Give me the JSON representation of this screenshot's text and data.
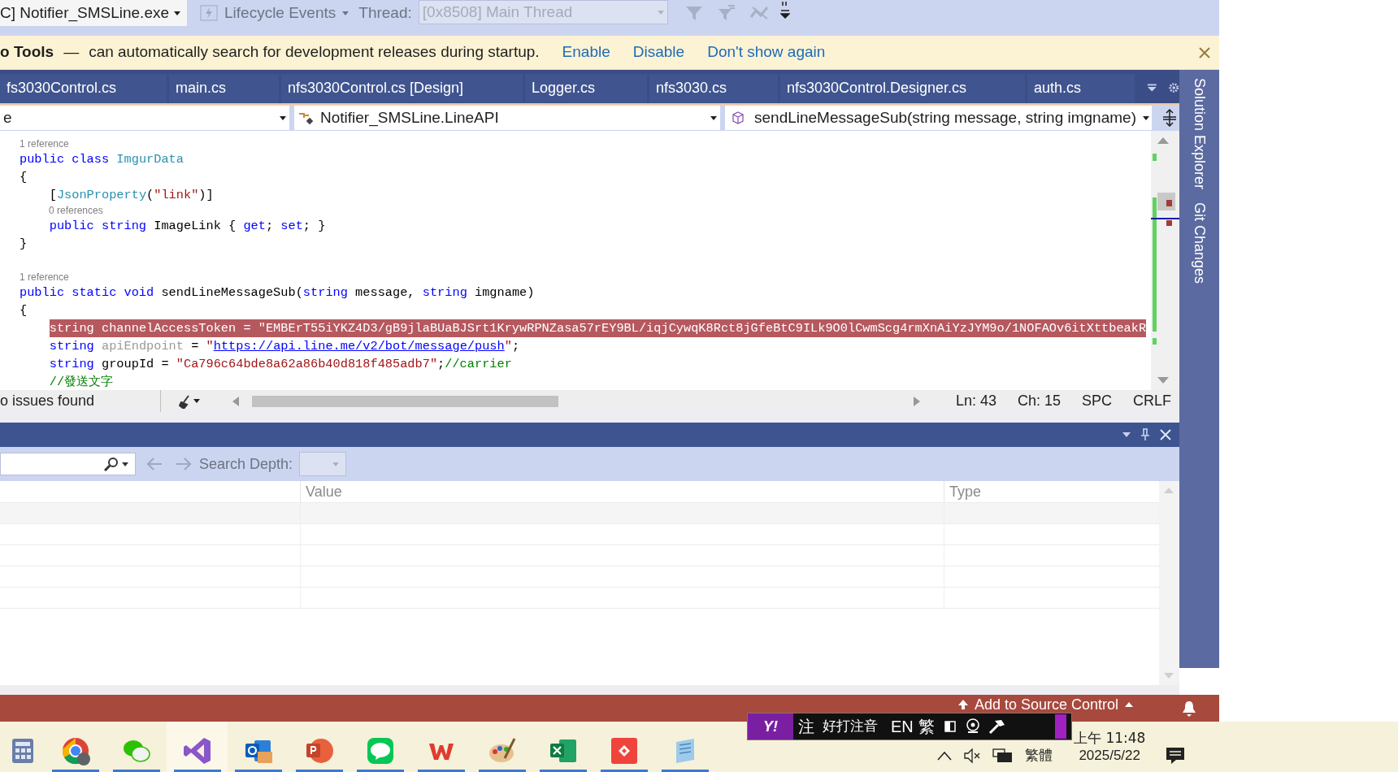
{
  "toolbar": {
    "process": "C] Notifier_SMSLine.exe",
    "lifecycle": "Lifecycle Events",
    "thread_label": "Thread:",
    "thread": {
      "value": "[0x8508] Main Thread",
      "disabled": true
    }
  },
  "infobar": {
    "title": "o Tools",
    "dash": "—",
    "message": "can automatically search for development releases during startup.",
    "links": [
      "Enable",
      "Disable",
      "Don't show again"
    ]
  },
  "tabs": [
    "fs3030Control.cs",
    "main.cs",
    "nfs3030Control.cs [Design]",
    "Logger.cs",
    "nfs3030.cs",
    "nfs3030Control.Designer.cs",
    "auth.cs"
  ],
  "nav": {
    "project": "e",
    "class": "Notifier_SMSLine.LineAPI",
    "member": "sendLineMessageSub(string message, string imgname)"
  },
  "code_lines": [
    {
      "kind": "reference",
      "text": "1 reference",
      "indented": false
    },
    {
      "kind": "code",
      "highlighted": false,
      "tokens": [
        {
          "t": "public class ",
          "kind": "kw"
        },
        {
          "t": "ImgurData",
          "kind": "type"
        }
      ]
    },
    {
      "kind": "code",
      "highlighted": false,
      "tokens": [
        {
          "t": "{",
          "kind": "plain"
        }
      ]
    },
    {
      "kind": "code",
      "highlighted": false,
      "tokens": [
        {
          "t": "    [",
          "kind": "plain"
        },
        {
          "t": "JsonProperty",
          "kind": "type"
        },
        {
          "t": "(",
          "kind": "plain"
        },
        {
          "t": "\"link\"",
          "kind": "str"
        },
        {
          "t": ")]",
          "kind": "plain"
        }
      ]
    },
    {
      "kind": "reference",
      "text": "0 references",
      "indented": true
    },
    {
      "kind": "code",
      "highlighted": false,
      "tokens": [
        {
          "t": "    public string ",
          "kind": "kw"
        },
        {
          "t": "ImageLink { ",
          "kind": "plain"
        },
        {
          "t": "get",
          "kind": "kw"
        },
        {
          "t": "; ",
          "kind": "plain"
        },
        {
          "t": "set",
          "kind": "kw"
        },
        {
          "t": "; }",
          "kind": "plain"
        }
      ]
    },
    {
      "kind": "code",
      "highlighted": false,
      "tokens": [
        {
          "t": "}",
          "kind": "plain"
        }
      ]
    },
    {
      "kind": "blank"
    },
    {
      "kind": "reference",
      "text": "1 reference",
      "indented": false
    },
    {
      "kind": "code",
      "highlighted": false,
      "tokens": [
        {
          "t": "public static void ",
          "kind": "kw"
        },
        {
          "t": "sendLineMessageSub(",
          "kind": "plain"
        },
        {
          "t": "string ",
          "kind": "kw"
        },
        {
          "t": "message, ",
          "kind": "plain"
        },
        {
          "t": "string ",
          "kind": "kw"
        },
        {
          "t": "imgname)",
          "kind": "plain"
        }
      ]
    },
    {
      "kind": "code",
      "highlighted": false,
      "tokens": [
        {
          "t": "{",
          "kind": "plain"
        }
      ]
    },
    {
      "kind": "code",
      "highlighted": true,
      "tokens": [
        {
          "t": "    string ",
          "kind": "kw"
        },
        {
          "t": "channelAccessToken = ",
          "kind": "plain"
        },
        {
          "t": "\"EMBErT55iYKZ4D3/gB9jlaBUaBJSrt1KrywRPNZasa57rEY9BL/iqjCywqK8Rct8jGfeBtC9ILk9O0lCwmScg4rmXnAiYzJYM9o/1NOFAOv6itXttbeakR",
          "kind": "str"
        }
      ]
    },
    {
      "kind": "code",
      "highlighted": false,
      "tokens": [
        {
          "t": "    string ",
          "kind": "kw"
        },
        {
          "t": "apiEndpoint",
          "kind": "dim"
        },
        {
          "t": " = ",
          "kind": "plain"
        },
        {
          "t": "\"",
          "kind": "str"
        },
        {
          "t": "https://api.line.me/v2/bot/message/push",
          "kind": "link"
        },
        {
          "t": "\"",
          "kind": "str"
        },
        {
          "t": ";",
          "kind": "plain"
        }
      ]
    },
    {
      "kind": "code",
      "highlighted": false,
      "tokens": [
        {
          "t": "    string ",
          "kind": "kw"
        },
        {
          "t": "groupId = ",
          "kind": "plain"
        },
        {
          "t": "\"Ca796c64bde8a62a86b40d818f485adb7\"",
          "kind": "str"
        },
        {
          "t": ";",
          "kind": "plain"
        },
        {
          "t": "//carrier",
          "kind": "cm"
        }
      ]
    },
    {
      "kind": "code",
      "highlighted": false,
      "tokens": [
        {
          "t": "    //發送文字",
          "kind": "cm"
        }
      ]
    }
  ],
  "editor_status": {
    "issues": "o issues found",
    "position": [
      "Ln: 43",
      "Ch: 15",
      "SPC",
      "CRLF"
    ]
  },
  "side_tabs": [
    "Solution Explorer",
    "Git Changes"
  ],
  "panel": {
    "search_depth_label": "Search Depth:",
    "columns": [
      "Value",
      "Type"
    ]
  },
  "status_bar": {
    "source_control": "Add to Source Control"
  },
  "ime_bar": {
    "logo": "Y!",
    "mode": "注",
    "input_method": "好打注音",
    "language": "EN",
    "script": "繁"
  },
  "taskbar": {
    "apps": [
      {
        "kind": "calculator",
        "running": false,
        "active": false
      },
      {
        "kind": "chrome",
        "running": true,
        "active": false
      },
      {
        "kind": "wechat",
        "running": true,
        "active": false
      },
      {
        "kind": "visualstudio",
        "running": true,
        "active": true
      },
      {
        "kind": "outlook",
        "running": true,
        "active": false
      },
      {
        "kind": "powerpoint",
        "running": true,
        "active": false
      },
      {
        "kind": "line",
        "running": true,
        "active": false
      },
      {
        "kind": "wps",
        "running": true,
        "active": false
      },
      {
        "kind": "paint",
        "running": true,
        "active": false
      },
      {
        "kind": "excel",
        "running": true,
        "active": false
      },
      {
        "kind": "anydesk",
        "running": true,
        "active": false
      },
      {
        "kind": "notepad",
        "running": true,
        "active": false
      }
    ],
    "tray": {
      "ime": "繁體",
      "time": "上午 11:48",
      "date": "2025/5/22"
    }
  }
}
